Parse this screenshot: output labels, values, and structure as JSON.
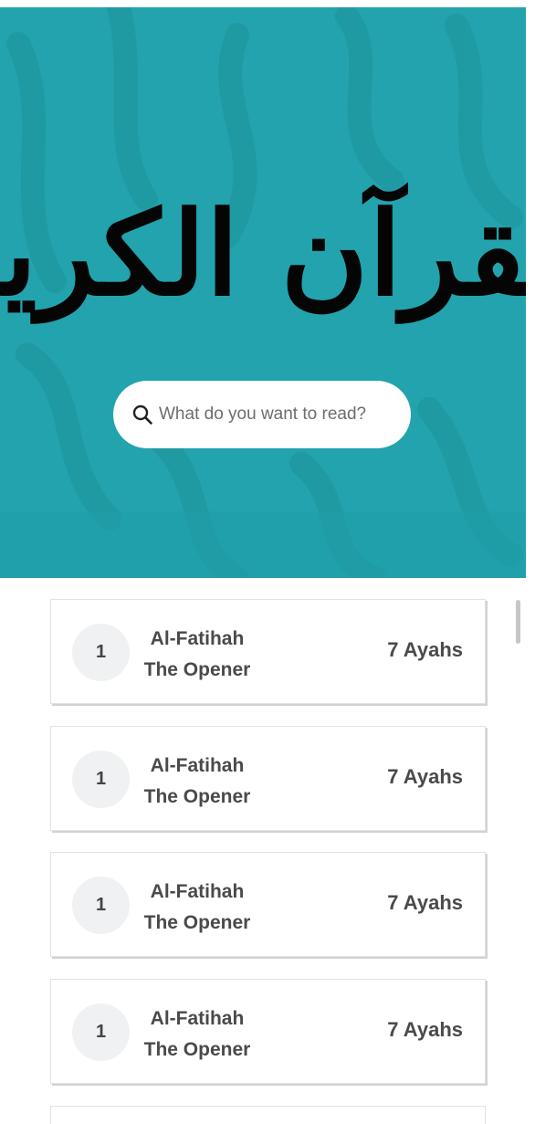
{
  "hero": {
    "title_calligraphy": "القرآن الكريم",
    "background_color": "#22a3ad"
  },
  "search": {
    "placeholder": "What do you want to read?",
    "icon": "search-icon"
  },
  "surahs": [
    {
      "number": "1",
      "name": "Al-Fatihah",
      "translation": "The Opener",
      "ayahs": "7 Ayahs"
    },
    {
      "number": "1",
      "name": "Al-Fatihah",
      "translation": "The Opener",
      "ayahs": "7 Ayahs"
    },
    {
      "number": "1",
      "name": "Al-Fatihah",
      "translation": "The Opener",
      "ayahs": "7 Ayahs"
    },
    {
      "number": "1",
      "name": "Al-Fatihah",
      "translation": "The Opener",
      "ayahs": "7 Ayahs"
    }
  ]
}
